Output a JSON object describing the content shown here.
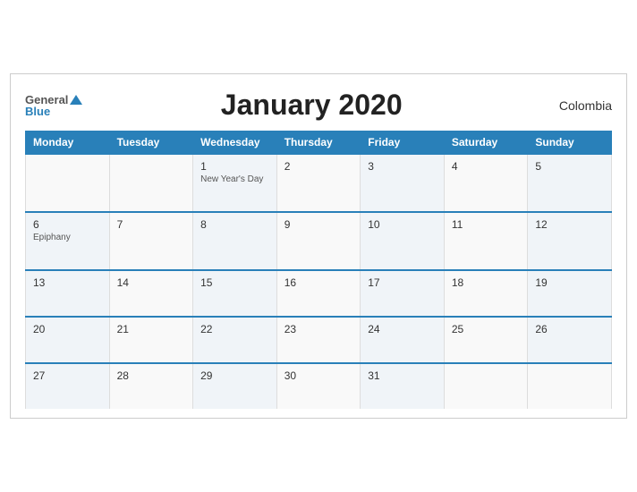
{
  "header": {
    "title": "January 2020",
    "country": "Colombia",
    "logo_general": "General",
    "logo_blue": "Blue"
  },
  "weekdays": [
    "Monday",
    "Tuesday",
    "Wednesday",
    "Thursday",
    "Friday",
    "Saturday",
    "Sunday"
  ],
  "weeks": [
    [
      {
        "day": "",
        "holiday": ""
      },
      {
        "day": "",
        "holiday": ""
      },
      {
        "day": "1",
        "holiday": "New Year's Day"
      },
      {
        "day": "2",
        "holiday": ""
      },
      {
        "day": "3",
        "holiday": ""
      },
      {
        "day": "4",
        "holiday": ""
      },
      {
        "day": "5",
        "holiday": ""
      }
    ],
    [
      {
        "day": "6",
        "holiday": "Epiphany"
      },
      {
        "day": "7",
        "holiday": ""
      },
      {
        "day": "8",
        "holiday": ""
      },
      {
        "day": "9",
        "holiday": ""
      },
      {
        "day": "10",
        "holiday": ""
      },
      {
        "day": "11",
        "holiday": ""
      },
      {
        "day": "12",
        "holiday": ""
      }
    ],
    [
      {
        "day": "13",
        "holiday": ""
      },
      {
        "day": "14",
        "holiday": ""
      },
      {
        "day": "15",
        "holiday": ""
      },
      {
        "day": "16",
        "holiday": ""
      },
      {
        "day": "17",
        "holiday": ""
      },
      {
        "day": "18",
        "holiday": ""
      },
      {
        "day": "19",
        "holiday": ""
      }
    ],
    [
      {
        "day": "20",
        "holiday": ""
      },
      {
        "day": "21",
        "holiday": ""
      },
      {
        "day": "22",
        "holiday": ""
      },
      {
        "day": "23",
        "holiday": ""
      },
      {
        "day": "24",
        "holiday": ""
      },
      {
        "day": "25",
        "holiday": ""
      },
      {
        "day": "26",
        "holiday": ""
      }
    ],
    [
      {
        "day": "27",
        "holiday": ""
      },
      {
        "day": "28",
        "holiday": ""
      },
      {
        "day": "29",
        "holiday": ""
      },
      {
        "day": "30",
        "holiday": ""
      },
      {
        "day": "31",
        "holiday": ""
      },
      {
        "day": "",
        "holiday": ""
      },
      {
        "day": "",
        "holiday": ""
      }
    ]
  ]
}
